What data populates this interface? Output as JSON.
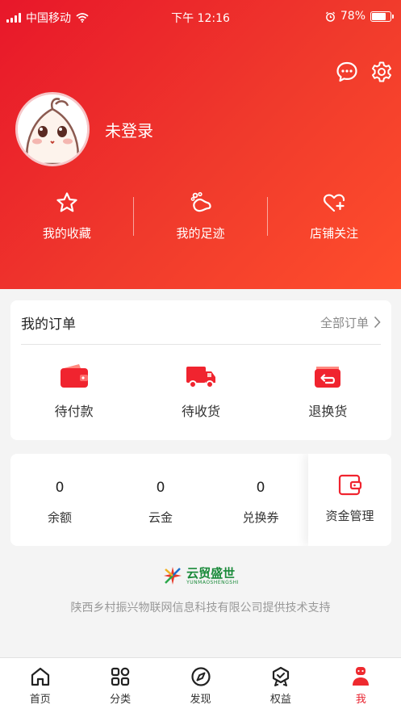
{
  "status_bar": {
    "carrier": "中国移动",
    "time": "下午 12:16",
    "battery": "78%",
    "battery_level": 0.78
  },
  "header": {
    "message_icon": "chat-bubble-icon",
    "settings_icon": "gear-icon",
    "login_label": "未登录",
    "quick_links": [
      {
        "label": "我的收藏",
        "icon": "star-icon"
      },
      {
        "label": "我的足迹",
        "icon": "footprint-icon"
      },
      {
        "label": "店铺关注",
        "icon": "heart-plus-icon"
      }
    ]
  },
  "orders": {
    "title": "我的订单",
    "all_label": "全部订单",
    "items": [
      {
        "label": "待付款",
        "icon": "wallet-icon"
      },
      {
        "label": "待收货",
        "icon": "truck-icon"
      },
      {
        "label": "退换货",
        "icon": "return-icon"
      }
    ]
  },
  "funds": {
    "items": [
      {
        "value": "0",
        "label": "余额"
      },
      {
        "value": "0",
        "label": "云金"
      },
      {
        "value": "0",
        "label": "兑换券"
      }
    ],
    "manage_label": "资金管理"
  },
  "footer": {
    "brand_cn": "云贸盛世",
    "brand_en": "YUNMAOSHENGSHI",
    "support_text": "陕西乡村振兴物联网信息科技有限公司提供技术支持"
  },
  "tabbar": {
    "tabs": [
      {
        "label": "首页",
        "icon": "home-icon"
      },
      {
        "label": "分类",
        "icon": "category-icon"
      },
      {
        "label": "发现",
        "icon": "compass-icon"
      },
      {
        "label": "权益",
        "icon": "badge-icon"
      },
      {
        "label": "我",
        "icon": "profile-icon"
      }
    ],
    "active_index": 4
  },
  "colors": {
    "primary": "#e8172a",
    "accent": "#ff4e2c",
    "active_tab": "#e8232f",
    "brand_green": "#1a8a3a"
  }
}
